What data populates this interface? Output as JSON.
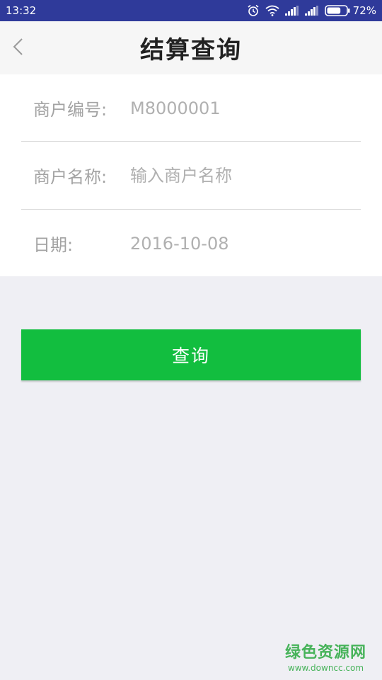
{
  "status_bar": {
    "time": "13:32",
    "battery": "72%",
    "battery_level": 0.72
  },
  "header": {
    "title": "结算查询",
    "back_icon": "chevron-left-icon"
  },
  "form": {
    "merchant_id": {
      "label": "商户编号:",
      "value": "M8000001"
    },
    "merchant_name": {
      "label": "商户名称:",
      "placeholder": "输入商户名称"
    },
    "date": {
      "label": "日期:",
      "value": "2016-10-08"
    }
  },
  "actions": {
    "query_label": "查询"
  },
  "watermark": {
    "title": "绿色资源网",
    "url": "www.downcc.com"
  },
  "colors": {
    "status_bar": "#2f3a9a",
    "primary_button": "#12be3f",
    "background": "#efeff4",
    "watermark": "#47b35a"
  }
}
